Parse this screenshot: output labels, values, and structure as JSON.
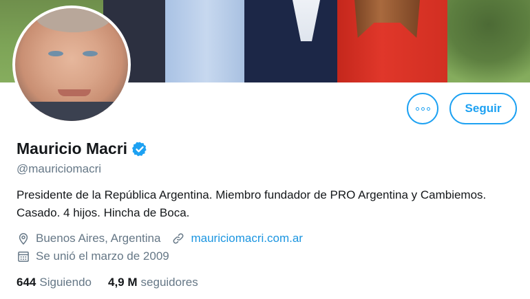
{
  "profile": {
    "name": "Mauricio Macri",
    "handle": "@mauriciomacri",
    "verified": true,
    "bio": "Presidente de la República Argentina. Miembro fundador de PRO Argentina y Cambiemos. Casado. 4 hijos. Hincha de Boca.",
    "location": "Buenos Aires, Argentina",
    "website": "mauriciomacri.com.ar",
    "joined": "Se unió el marzo de 2009"
  },
  "actions": {
    "follow_label": "Seguir",
    "more_icon": "more-options-icon"
  },
  "stats": {
    "following_count": "644",
    "following_label": "Siguiendo",
    "followers_count": "4,9 M",
    "followers_label": "seguidores"
  },
  "colors": {
    "accent": "#1da1f2",
    "link": "#1b95e0",
    "secondary_text": "#657786",
    "primary_text": "#14171a"
  }
}
